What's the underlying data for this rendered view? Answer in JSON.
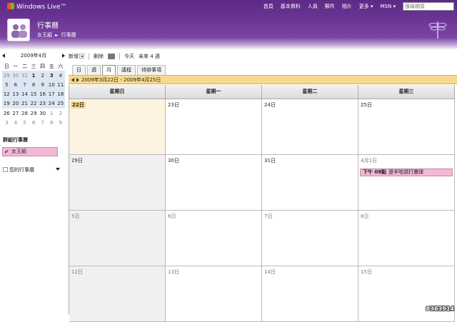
{
  "header": {
    "brand": "Windows Live™",
    "nav": [
      "首頁",
      "基本資料",
      "人員",
      "郵件",
      "相片",
      "更多",
      "MSN"
    ],
    "search_placeholder": "搜尋網頁",
    "app_title": "行事曆",
    "breadcrumb": [
      "女王組",
      "行事曆"
    ]
  },
  "mini_calendar": {
    "month_label": "2009年4月",
    "weekdays": [
      "日",
      "一",
      "二",
      "三",
      "四",
      "五",
      "六"
    ],
    "weeks": [
      [
        "29",
        "30",
        "31",
        "1",
        "2",
        "3",
        "4"
      ],
      [
        "5",
        "6",
        "7",
        "8",
        "9",
        "10",
        "11"
      ],
      [
        "12",
        "13",
        "14",
        "15",
        "16",
        "17",
        "18"
      ],
      [
        "19",
        "20",
        "21",
        "22",
        "23",
        "24",
        "25"
      ],
      [
        "26",
        "27",
        "28",
        "29",
        "30",
        "1",
        "2"
      ],
      [
        "3",
        "4",
        "5",
        "6",
        "7",
        "8",
        "9"
      ]
    ]
  },
  "sidebar": {
    "group_heading": "群組行事曆",
    "group_calendar": "女王組",
    "my_calendars": "您的行事曆"
  },
  "toolbar": {
    "new": "新增",
    "delete": "刪除",
    "today": "今天",
    "next4": "未來 4 週"
  },
  "view_tabs": [
    "日",
    "週",
    "月",
    "議程",
    "待辦事項"
  ],
  "active_view": "月",
  "range_label": "2009年3月22日 - 2009年4月25日",
  "grid": {
    "headers": [
      "星期日",
      "星期一",
      "星期二",
      "星期三"
    ],
    "weeks": [
      [
        "22日",
        "23日",
        "24日",
        "25日"
      ],
      [
        "29日",
        "30日",
        "31日",
        "4月1日"
      ],
      [
        "5日",
        "6日",
        "7日",
        "8日"
      ],
      [
        "12日",
        "13日",
        "14日",
        "15日"
      ]
    ],
    "event": {
      "time": "下午 08點",
      "title": "是羊啦請打壘球"
    }
  },
  "watermark": "#363914",
  "colors": {
    "header": "#6a3594",
    "event": "#f3b8d5",
    "highlight": "#f7d98a"
  }
}
